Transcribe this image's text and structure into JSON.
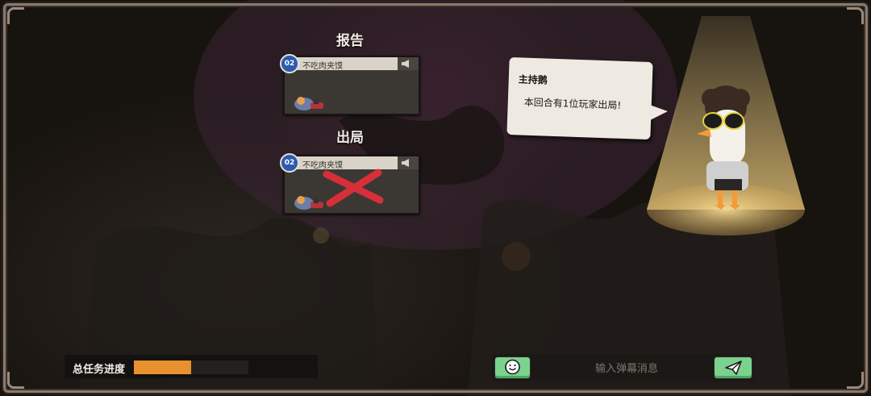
{
  "report_section": {
    "title": "报告",
    "card": {
      "number": "02",
      "player_name": "不吃肉夹馍"
    }
  },
  "out_section": {
    "title": "出局",
    "card": {
      "number": "02",
      "player_name": "不吃肉夹馍"
    }
  },
  "host": {
    "name": "主持鹅",
    "message": "本回合有1位玩家出局!"
  },
  "task_progress": {
    "label": "总任务进度",
    "fraction": 0.5,
    "fill_color": "#e8922f"
  },
  "chat": {
    "placeholder": "输入弹幕消息",
    "emoji_icon": "smiley-face-icon",
    "send_icon": "paper-plane-icon",
    "button_color": "#7bd28e"
  },
  "colors": {
    "eliminated_mark": "#d62f3a",
    "number_badge": "#2e5bb0"
  }
}
